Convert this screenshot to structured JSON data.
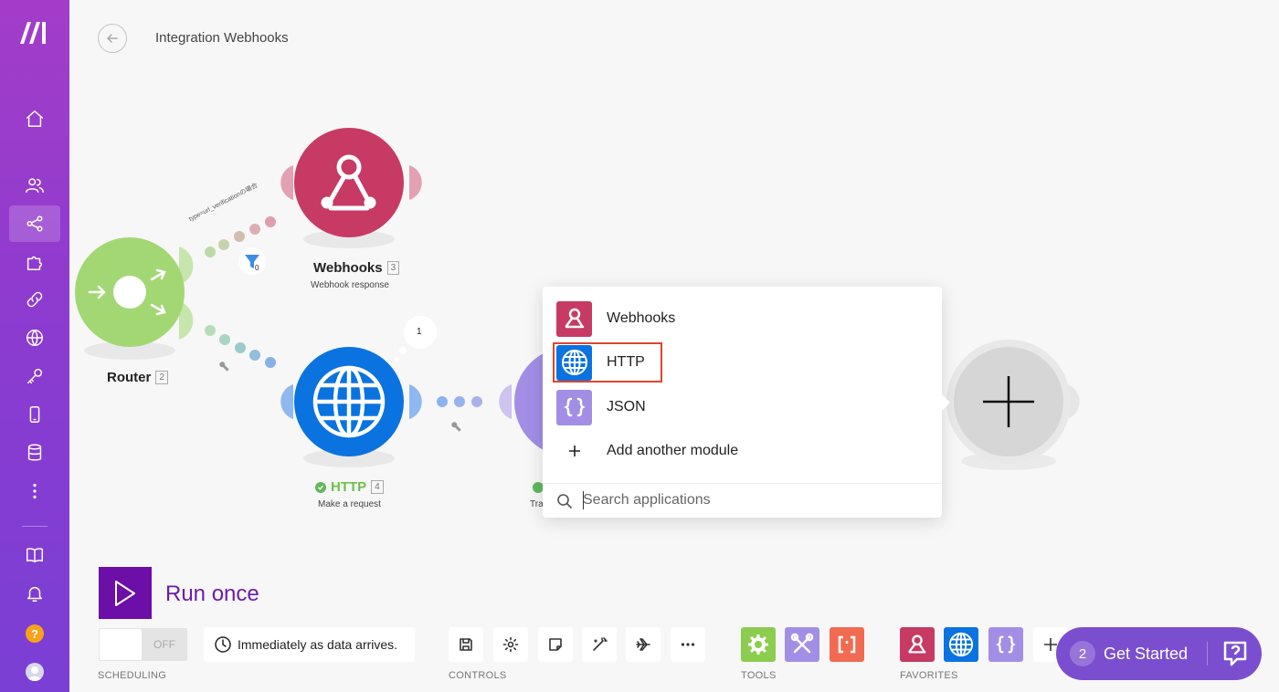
{
  "header": {
    "title": "Integration Webhooks"
  },
  "canvas": {
    "filter_label": "type=url_verificationの場合",
    "filter_count": "0",
    "bubble_count": "1",
    "modules": [
      {
        "name": "Router",
        "num": "2"
      },
      {
        "name": "Webhooks",
        "num": "3",
        "sub": "Webhook response"
      },
      {
        "name": "HTTP",
        "num": "4",
        "sub": "Make a request"
      },
      {
        "name": "",
        "num": "",
        "sub": "Tra"
      }
    ]
  },
  "popup": {
    "items": [
      {
        "label": "Webhooks",
        "icon": "webhooks-icon",
        "color": "#c73a63"
      },
      {
        "label": "HTTP",
        "icon": "globe-icon",
        "color": "#0b73e0"
      },
      {
        "label": "JSON",
        "icon": "braces-icon",
        "color": "#a38ee6"
      },
      {
        "label": "Add another module",
        "icon": "plus-icon"
      }
    ],
    "search_placeholder": "Search applications"
  },
  "run": {
    "label": "Run once"
  },
  "scheduling": {
    "toggle": "OFF",
    "text": "Immediately as data arrives.",
    "label": "SCHEDULING"
  },
  "controls": {
    "label": "CONTROLS"
  },
  "tools": {
    "label": "TOOLS"
  },
  "favorites": {
    "label": "FAVORITES"
  },
  "get_started": {
    "count": "2",
    "label": "Get Started"
  },
  "sidebar": {
    "help": "?"
  },
  "colors": {
    "accent": "#6c0ea8",
    "sidebar": "#8b3bd0",
    "router": "#9fd46c",
    "webhook": "#c73a63",
    "http": "#0b73e0"
  }
}
